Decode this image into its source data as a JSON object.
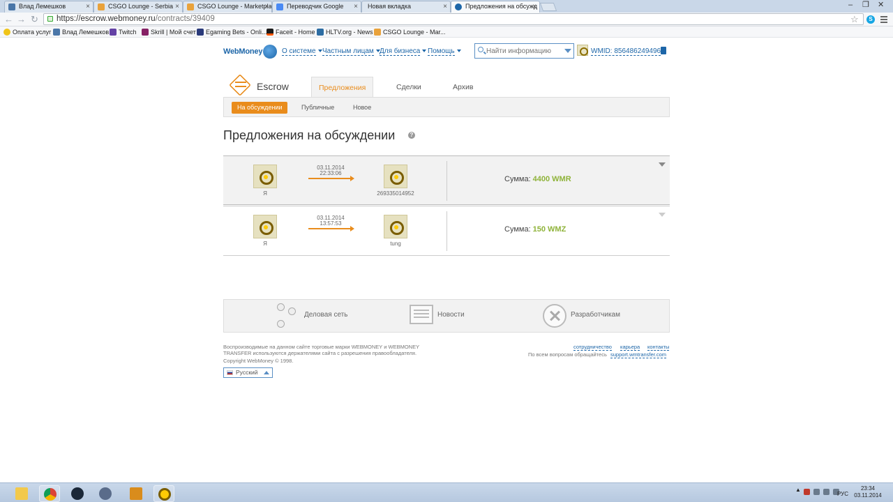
{
  "browser": {
    "tabs": [
      {
        "title": "Влад Лемешков",
        "active": false
      },
      {
        "title": "CSGO Lounge - Serbia",
        "active": false
      },
      {
        "title": "CSGO Lounge - Marketpla",
        "active": false
      },
      {
        "title": "Переводчик Google",
        "active": false
      },
      {
        "title": "Новая вкладка",
        "active": false
      },
      {
        "title": "Предложения на обсужд",
        "active": true
      }
    ],
    "url_host": "https://escrow.webmoney.ru",
    "url_path": "/contracts/39409",
    "bookmarks": [
      "Оплата услуг",
      "Влад Лемешков",
      "Twitch",
      "Skrill | Мой счет",
      "Egaming Bets - Onli...",
      "Faceit - Home",
      "HLTV.org - News",
      "CSGO Lounge - Mar..."
    ]
  },
  "site": {
    "logo_text": "WebMoney",
    "nav": [
      "О системе",
      "Частным лицам",
      "Для бизнеса",
      "Помощь"
    ],
    "search_placeholder": "Найти информацию",
    "wmid": "WMID: 856486249496"
  },
  "escrow": {
    "title": "Escrow",
    "main_tabs": [
      "Предложения",
      "Сделки",
      "Архив"
    ],
    "sub_tabs": [
      "На обсуждении",
      "Публичные",
      "Новое"
    ],
    "page_title": "Предложения на обсуждении",
    "help": "?",
    "sum_label": "Сумма:",
    "deals": [
      {
        "from": "Я",
        "date": "03.11.2014",
        "time": "22:33:06",
        "to": "269335014952",
        "amount": "4400 WMR"
      },
      {
        "from": "Я",
        "date": "03.11.2014",
        "time": "13:57:53",
        "to": "tung",
        "amount": "150 WMZ"
      }
    ]
  },
  "footer": {
    "sections": [
      "Деловая сеть",
      "Новости",
      "Разработчикам"
    ],
    "legal": "Воспроизводимые на данном сайте торговые марки WEBMONEY и WEBMONEY TRANSFER используются держателями сайта с разрешения правообладателя.",
    "copyright": "Copyright WebMoney © 1998.",
    "links": [
      "сотрудничество",
      "карьера",
      "контакты"
    ],
    "support_text": "По всем вопросам обращайтесь",
    "support_link": "support.wmtransfer.com",
    "language": "Русский"
  },
  "taskbar": {
    "lang": "РУС",
    "time": "23:34",
    "date": "03.11.2014"
  },
  "colors": {
    "accent": "#e98c1c",
    "link": "#1d66a8",
    "amount": "#8fb33a"
  }
}
